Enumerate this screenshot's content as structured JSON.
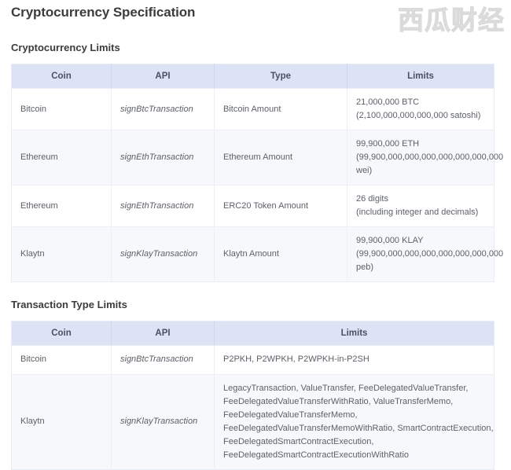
{
  "watermark": {
    "text": "西瓜财经"
  },
  "document": {
    "title": "Cryptocurrency Specification"
  },
  "sections": [
    {
      "heading": "Cryptocurrency Limits",
      "table": {
        "columns": [
          "Coin",
          "API",
          "Type",
          "Limits"
        ],
        "rows": [
          {
            "coin": "Bitcoin",
            "api": "signBtcTransaction",
            "type": "Bitcoin Amount",
            "limits": [
              "21,000,000 BTC",
              "(2,100,000,000,000,000 satoshi)"
            ]
          },
          {
            "coin": "Ethereum",
            "api": "signEthTransaction",
            "type": "Ethereum Amount",
            "limits": [
              "99,900,000 ETH",
              "(99,900,000,000,000,000,000,000,000",
              "wei)"
            ]
          },
          {
            "coin": "Ethereum",
            "api": "signEthTransaction",
            "type": "ERC20 Token Amount",
            "limits": [
              "26 digits",
              "(including integer and decimals)"
            ]
          },
          {
            "coin": "Klaytn",
            "api": "signKlayTransaction",
            "type": "Klaytn Amount",
            "limits": [
              "99,900,000 KLAY",
              "(99,900,000,000,000,000,000,000,000",
              "peb)"
            ]
          }
        ]
      }
    },
    {
      "heading": "Transaction Type Limits",
      "table": {
        "columns": [
          "Coin",
          "API",
          "Limits"
        ],
        "rows": [
          {
            "coin": "Bitcoin",
            "api": "signBtcTransaction",
            "limits": [
              "P2PKH, P2WPKH, P2WPKH-in-P2SH"
            ]
          },
          {
            "coin": "Klaytn",
            "api": "signKlayTransaction",
            "limits": [
              "LegacyTransaction, ValueTransfer, FeeDelegatedValueTransfer,",
              "FeeDelegatedValueTransferWithRatio, ValueTransferMemo,",
              "FeeDelegatedValueTransferMemo,",
              "FeeDelegatedValueTransferMemoWithRatio, SmartContractExecution,",
              "FeeDelegatedSmartContractExecution,",
              "FeeDelegatedSmartContractExecutionWithRatio"
            ]
          }
        ]
      }
    }
  ]
}
